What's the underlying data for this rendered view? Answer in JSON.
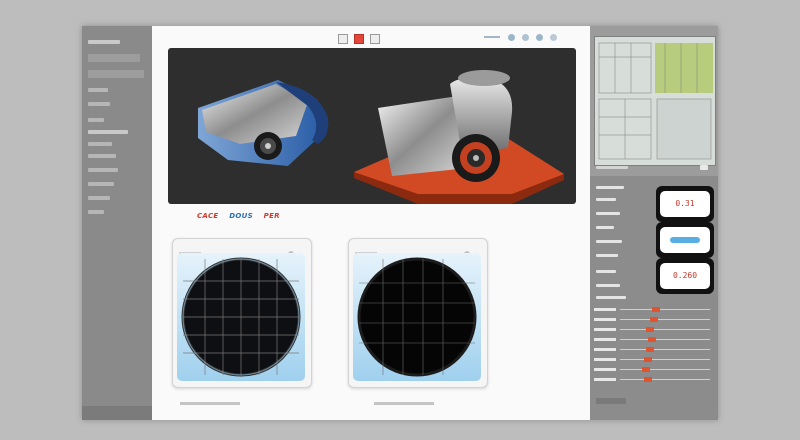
{
  "app": {
    "sidebar_heading": "",
    "labels": [
      "CACE",
      "DOUS",
      "PER"
    ],
    "label_colors": [
      "#d33a2c",
      "#2a6fb3",
      "#d33a2c"
    ],
    "gauges": [
      {
        "value": "0.31"
      },
      {
        "value": ""
      },
      {
        "value": "0.260"
      }
    ],
    "colors": {
      "accent": "#e0532f",
      "viewport": "#2e2e2e",
      "lens_bg": "#9fd0ee"
    },
    "icons": [
      "toolbar-button-icon",
      "record-icon",
      "layer-icon",
      "settings-icon",
      "view-icon"
    ]
  }
}
